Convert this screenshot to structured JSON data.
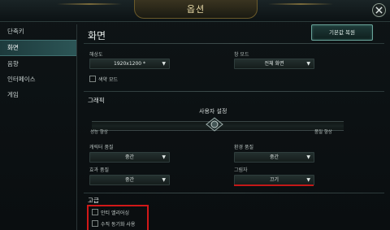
{
  "window": {
    "title": "옵션"
  },
  "sidebar": {
    "items": [
      {
        "label": "단축키"
      },
      {
        "label": "화면"
      },
      {
        "label": "음향"
      },
      {
        "label": "인터페이스"
      },
      {
        "label": "게임"
      }
    ],
    "active_index": 1
  },
  "main": {
    "title": "화면",
    "reset_button": "기본값 복원",
    "resolution": {
      "label": "해상도",
      "value": "1920x1200 *"
    },
    "window_mode": {
      "label": "창 모드",
      "value": "전체 화면"
    },
    "colorblind": {
      "label": "색약 모드",
      "checked": false
    },
    "graphics": {
      "heading": "그래픽",
      "slider_label": "사용자 설정",
      "left_label": "성능 향상",
      "right_label": "품질 향상"
    },
    "character_quality": {
      "label": "캐릭터 품질",
      "value": "중간"
    },
    "environment_quality": {
      "label": "환경 품질",
      "value": "중간"
    },
    "effects_quality": {
      "label": "효과 품질",
      "value": "중간"
    },
    "shadows": {
      "label": "그림자",
      "value": "끄기"
    },
    "advanced": {
      "heading": "고급",
      "antialiasing": {
        "label": "안티 앨리어싱",
        "checked": false
      },
      "vsync": {
        "label": "수직 동기화 사용",
        "checked": false
      }
    }
  },
  "colors": {
    "accent": "#2c5556",
    "highlight_red": "#d11818"
  }
}
